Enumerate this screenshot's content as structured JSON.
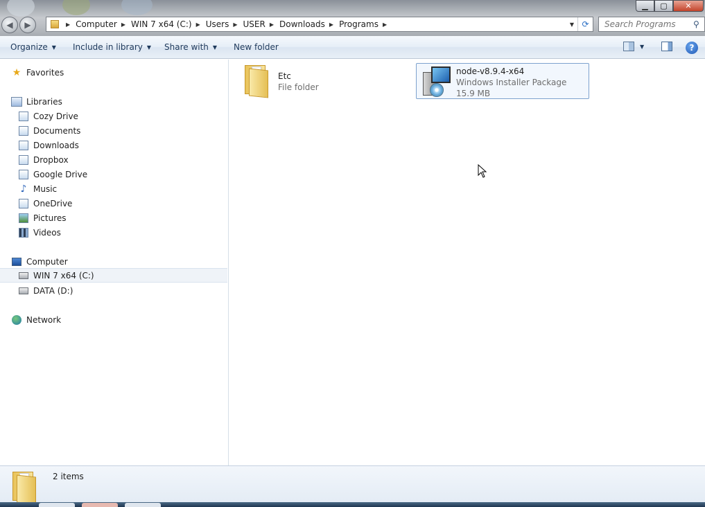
{
  "window": {
    "minimize_glyph": "▁",
    "maximize_glyph": "▢",
    "close_glyph": "✕"
  },
  "nav": {
    "back_glyph": "◀",
    "forward_glyph": "▶"
  },
  "address": {
    "crumbs": [
      "Computer",
      "WIN 7 x64 (C:)",
      "Users",
      "USER",
      "Downloads",
      "Programs"
    ],
    "sep_glyph": "▶",
    "dropdown_glyph": "▼",
    "refresh_glyph": "⟳"
  },
  "search": {
    "placeholder": "Search Programs",
    "icon_glyph": "⚲"
  },
  "toolbar": {
    "organize": "Organize",
    "include_in_library": "Include in library",
    "share_with": "Share with",
    "new_folder": "New folder",
    "caret": "▼",
    "help_glyph": "?"
  },
  "sidebar": {
    "favorites": "Favorites",
    "libraries": "Libraries",
    "library_items": [
      "Cozy Drive",
      "Documents",
      "Downloads",
      "Dropbox",
      "Google Drive",
      "Music",
      "OneDrive",
      "Pictures",
      "Videos"
    ],
    "computer": "Computer",
    "drives": [
      "WIN 7 x64 (C:)",
      "DATA (D:)"
    ],
    "network": "Network",
    "star_glyph": "★",
    "music_glyph": "♪"
  },
  "files": [
    {
      "name": "Etc",
      "type": "File folder",
      "size": ""
    },
    {
      "name": "node-v8.9.4-x64",
      "type": "Windows Installer Package",
      "size": "15.9 MB"
    }
  ],
  "status": {
    "item_count": "2 items"
  },
  "colors": {
    "accent": "#1e395b",
    "selection_border": "#7da2ce",
    "selection_fill": "#f2f7fd"
  }
}
